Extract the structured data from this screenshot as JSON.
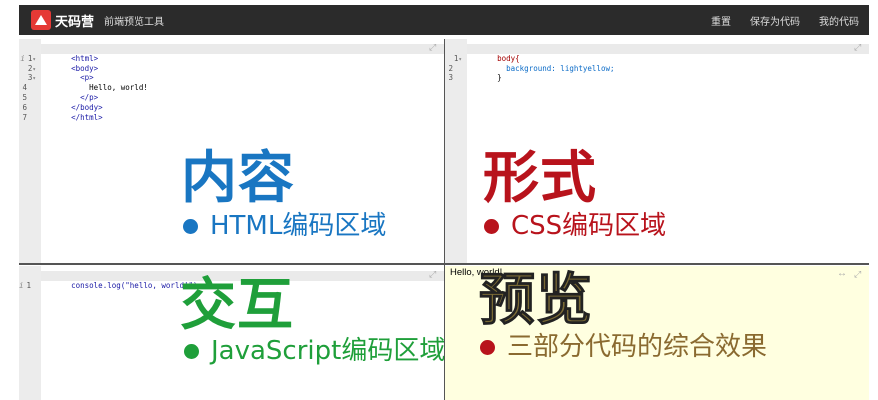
{
  "header": {
    "logo_text": "天码营",
    "tool_name": "前端预览工具",
    "actions": [
      "重置",
      "保存为代码",
      "我的代码"
    ]
  },
  "html_pane": {
    "lines": [
      {
        "n": "1",
        "fold": true,
        "text": "<html>"
      },
      {
        "n": "2",
        "fold": true,
        "text": "<body>"
      },
      {
        "n": "3",
        "fold": true,
        "text": "  <p>"
      },
      {
        "n": "4",
        "fold": false,
        "text": "    Hello, world!"
      },
      {
        "n": "5",
        "fold": false,
        "text": "  </p>"
      },
      {
        "n": "6",
        "fold": false,
        "text": "</body>"
      },
      {
        "n": "7",
        "fold": false,
        "text": "</html>"
      }
    ],
    "title": "内容",
    "subtitle": "HTML编码区域",
    "color": "#1976c2"
  },
  "css_pane": {
    "lines": [
      {
        "n": "1",
        "fold": true,
        "text": "body{"
      },
      {
        "n": "2",
        "fold": false,
        "text": "  background: lightyellow;"
      },
      {
        "n": "3",
        "fold": false,
        "text": "}"
      }
    ],
    "title": "形式",
    "subtitle": "CSS编码区域",
    "color": "#b8131c"
  },
  "js_pane": {
    "lines": [
      {
        "n": "1",
        "fold": false,
        "text": "console.log(\"hello, world!\")"
      }
    ],
    "title": "交互",
    "subtitle": "JavaScript编码区域",
    "color": "#1f9f3a"
  },
  "preview_pane": {
    "output_text": "Hello, world!",
    "title": "预览",
    "subtitle": "三部分代码的综合效果",
    "dot_color": "#b8131c",
    "background": "#ffffe0"
  }
}
